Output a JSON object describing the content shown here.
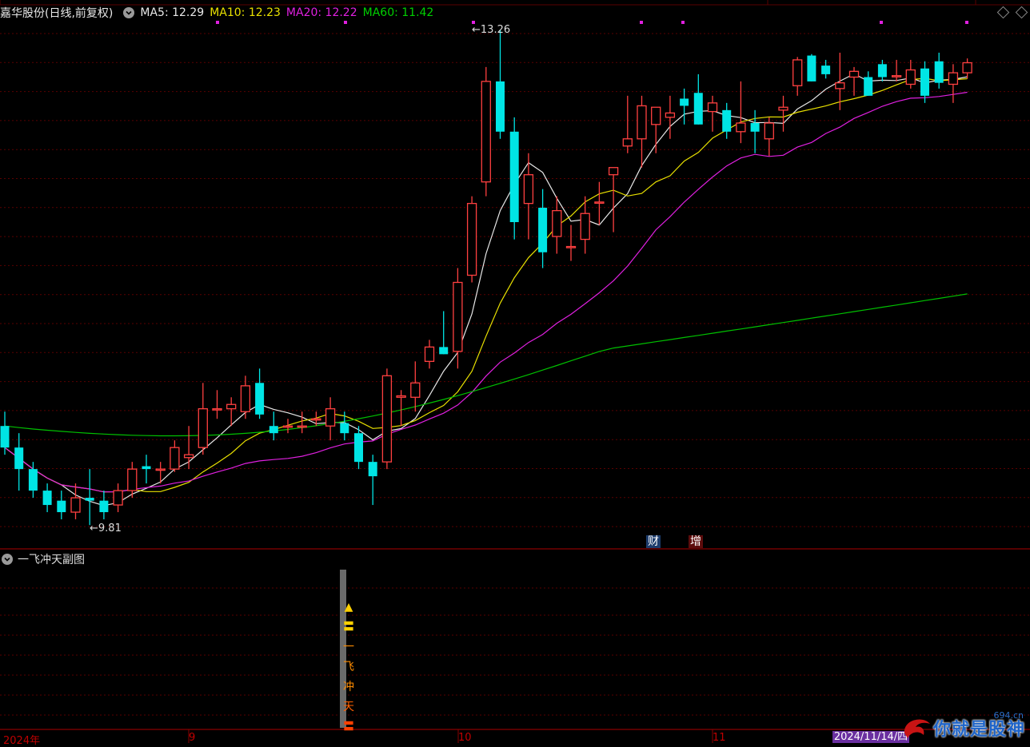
{
  "header": {
    "stock_label": "嘉华股份(日线,前复权)",
    "ma5": "MA5: 12.29",
    "ma10": "MA10: 12.23",
    "ma20": "MA20: 12.22",
    "ma60": "MA60: 11.42"
  },
  "chart": {
    "high_label": "13.26",
    "low_label": "9.81",
    "badge_cai": "财",
    "badge_zeng": "增"
  },
  "indicator": {
    "title": "一飞冲天副图",
    "signal_chars": [
      "▲",
      "〓",
      "一",
      "飞",
      "冲",
      "天",
      "〓"
    ]
  },
  "x_axis": {
    "labels": [
      "2024年",
      "9",
      "10",
      "11"
    ],
    "date_tag": "2024/11/14/四"
  },
  "watermark": {
    "text": "你就是股神",
    "site": "694.cn"
  },
  "colors": {
    "up": "#ff4040",
    "down": "#00e5e5",
    "ma5": "#e8e8e8",
    "ma10": "#e8e000",
    "ma20": "#e020e0",
    "ma60": "#00c000",
    "grid": "#5a0000"
  },
  "chart_data": {
    "type": "candlestick",
    "x": [
      "2024-08-01",
      "2024-08-02",
      "2024-08-05",
      "2024-08-06",
      "2024-08-07",
      "2024-08-08",
      "2024-08-09",
      "2024-08-12",
      "2024-08-13",
      "2024-08-14",
      "2024-08-15",
      "2024-08-16",
      "2024-08-19",
      "2024-08-20",
      "2024-08-21",
      "2024-08-22",
      "2024-08-23",
      "2024-08-26",
      "2024-08-27",
      "2024-08-28",
      "2024-08-29",
      "2024-08-30",
      "2024-09-02",
      "2024-09-03",
      "2024-09-04",
      "2024-09-05",
      "2024-09-06",
      "2024-09-09",
      "2024-09-10",
      "2024-09-11",
      "2024-09-12",
      "2024-09-13",
      "2024-09-18",
      "2024-09-19",
      "2024-09-20",
      "2024-09-23",
      "2024-09-24",
      "2024-09-25",
      "2024-09-26",
      "2024-09-27",
      "2024-09-30",
      "2024-10-08",
      "2024-10-09",
      "2024-10-10",
      "2024-10-11",
      "2024-10-14",
      "2024-10-15",
      "2024-10-16",
      "2024-10-17",
      "2024-10-18",
      "2024-10-21",
      "2024-10-22",
      "2024-10-23",
      "2024-10-24",
      "2024-10-25",
      "2024-10-28",
      "2024-10-29",
      "2024-10-30",
      "2024-10-31",
      "2024-11-01",
      "2024-11-04",
      "2024-11-05",
      "2024-11-06",
      "2024-11-07",
      "2024-11-08",
      "2024-11-11",
      "2024-11-12",
      "2024-11-13",
      "2024-11-14"
    ],
    "ohlc": [
      [
        10.5,
        10.6,
        10.3,
        10.35
      ],
      [
        10.35,
        10.45,
        10.05,
        10.2
      ],
      [
        10.2,
        10.25,
        10.0,
        10.05
      ],
      [
        10.05,
        10.1,
        9.9,
        9.95
      ],
      [
        9.98,
        10.05,
        9.85,
        9.9
      ],
      [
        9.9,
        10.1,
        9.85,
        10.0
      ],
      [
        10.0,
        10.2,
        9.81,
        9.98
      ],
      [
        9.98,
        10.05,
        9.85,
        9.9
      ],
      [
        9.95,
        10.1,
        9.9,
        10.05
      ],
      [
        10.05,
        10.25,
        10.0,
        10.2
      ],
      [
        10.22,
        10.3,
        10.1,
        10.2
      ],
      [
        10.2,
        10.25,
        10.1,
        10.2
      ],
      [
        10.2,
        10.4,
        10.18,
        10.35
      ],
      [
        10.28,
        10.5,
        10.2,
        10.3
      ],
      [
        10.35,
        10.8,
        10.3,
        10.62
      ],
      [
        10.62,
        10.75,
        10.55,
        10.62
      ],
      [
        10.62,
        10.7,
        10.5,
        10.65
      ],
      [
        10.6,
        10.85,
        10.55,
        10.78
      ],
      [
        10.8,
        10.9,
        10.55,
        10.58
      ],
      [
        10.5,
        10.6,
        10.4,
        10.45
      ],
      [
        10.5,
        10.55,
        10.45,
        10.5
      ],
      [
        10.5,
        10.6,
        10.45,
        10.5
      ],
      [
        10.55,
        10.6,
        10.5,
        10.55
      ],
      [
        10.5,
        10.7,
        10.4,
        10.62
      ],
      [
        10.52,
        10.6,
        10.4,
        10.45
      ],
      [
        10.45,
        10.5,
        10.2,
        10.25
      ],
      [
        10.25,
        10.3,
        9.95,
        10.15
      ],
      [
        10.25,
        10.9,
        10.2,
        10.85
      ],
      [
        10.7,
        10.75,
        10.5,
        10.71
      ],
      [
        10.7,
        10.95,
        10.6,
        10.8
      ],
      [
        10.95,
        11.1,
        10.9,
        11.05
      ],
      [
        11.05,
        11.3,
        11.0,
        11.0
      ],
      [
        11.02,
        11.6,
        10.9,
        11.5
      ],
      [
        11.55,
        12.1,
        11.5,
        12.05
      ],
      [
        12.2,
        13.0,
        12.1,
        12.9
      ],
      [
        12.9,
        13.26,
        12.5,
        12.55
      ],
      [
        12.55,
        12.65,
        11.8,
        11.92
      ],
      [
        12.05,
        12.4,
        11.8,
        12.25
      ],
      [
        12.02,
        12.15,
        11.6,
        11.71
      ],
      [
        11.82,
        12.1,
        11.7,
        12.0
      ],
      [
        11.75,
        11.9,
        11.65,
        11.75
      ],
      [
        11.8,
        12.1,
        11.7,
        11.98
      ],
      [
        12.06,
        12.2,
        11.9,
        12.06
      ],
      [
        12.25,
        12.3,
        11.85,
        12.3
      ],
      [
        12.45,
        12.8,
        12.4,
        12.5
      ],
      [
        12.5,
        12.8,
        12.3,
        12.73
      ],
      [
        12.6,
        12.7,
        12.4,
        12.72
      ],
      [
        12.65,
        12.8,
        12.5,
        12.68
      ],
      [
        12.78,
        12.85,
        12.6,
        12.73
      ],
      [
        12.82,
        12.95,
        12.6,
        12.6
      ],
      [
        12.69,
        12.8,
        12.55,
        12.75
      ],
      [
        12.7,
        12.75,
        12.5,
        12.55
      ],
      [
        12.55,
        12.9,
        12.47,
        12.61
      ],
      [
        12.61,
        12.7,
        12.4,
        12.55
      ],
      [
        12.5,
        12.65,
        12.38,
        12.61
      ],
      [
        12.7,
        12.8,
        12.55,
        12.72
      ],
      [
        12.87,
        13.07,
        12.8,
        13.05
      ],
      [
        13.08,
        13.09,
        12.9,
        12.9
      ],
      [
        13.01,
        13.05,
        12.92,
        12.95
      ],
      [
        12.85,
        13.1,
        12.7,
        12.89
      ],
      [
        12.93,
        13.0,
        12.8,
        12.97
      ],
      [
        12.93,
        12.97,
        12.8,
        12.8
      ],
      [
        13.02,
        13.05,
        12.9,
        12.93
      ],
      [
        12.94,
        13.05,
        12.9,
        12.94
      ],
      [
        12.88,
        13.05,
        12.85,
        12.98
      ],
      [
        12.99,
        13.04,
        12.75,
        12.8
      ],
      [
        13.04,
        13.1,
        12.85,
        12.89
      ],
      [
        12.88,
        13.02,
        12.75,
        12.96
      ],
      [
        12.96,
        13.06,
        12.92,
        13.03
      ]
    ],
    "ma60": {
      "start": 10.5,
      "end": 11.42
    },
    "high_marker": 13.26,
    "low_marker": 9.81
  }
}
